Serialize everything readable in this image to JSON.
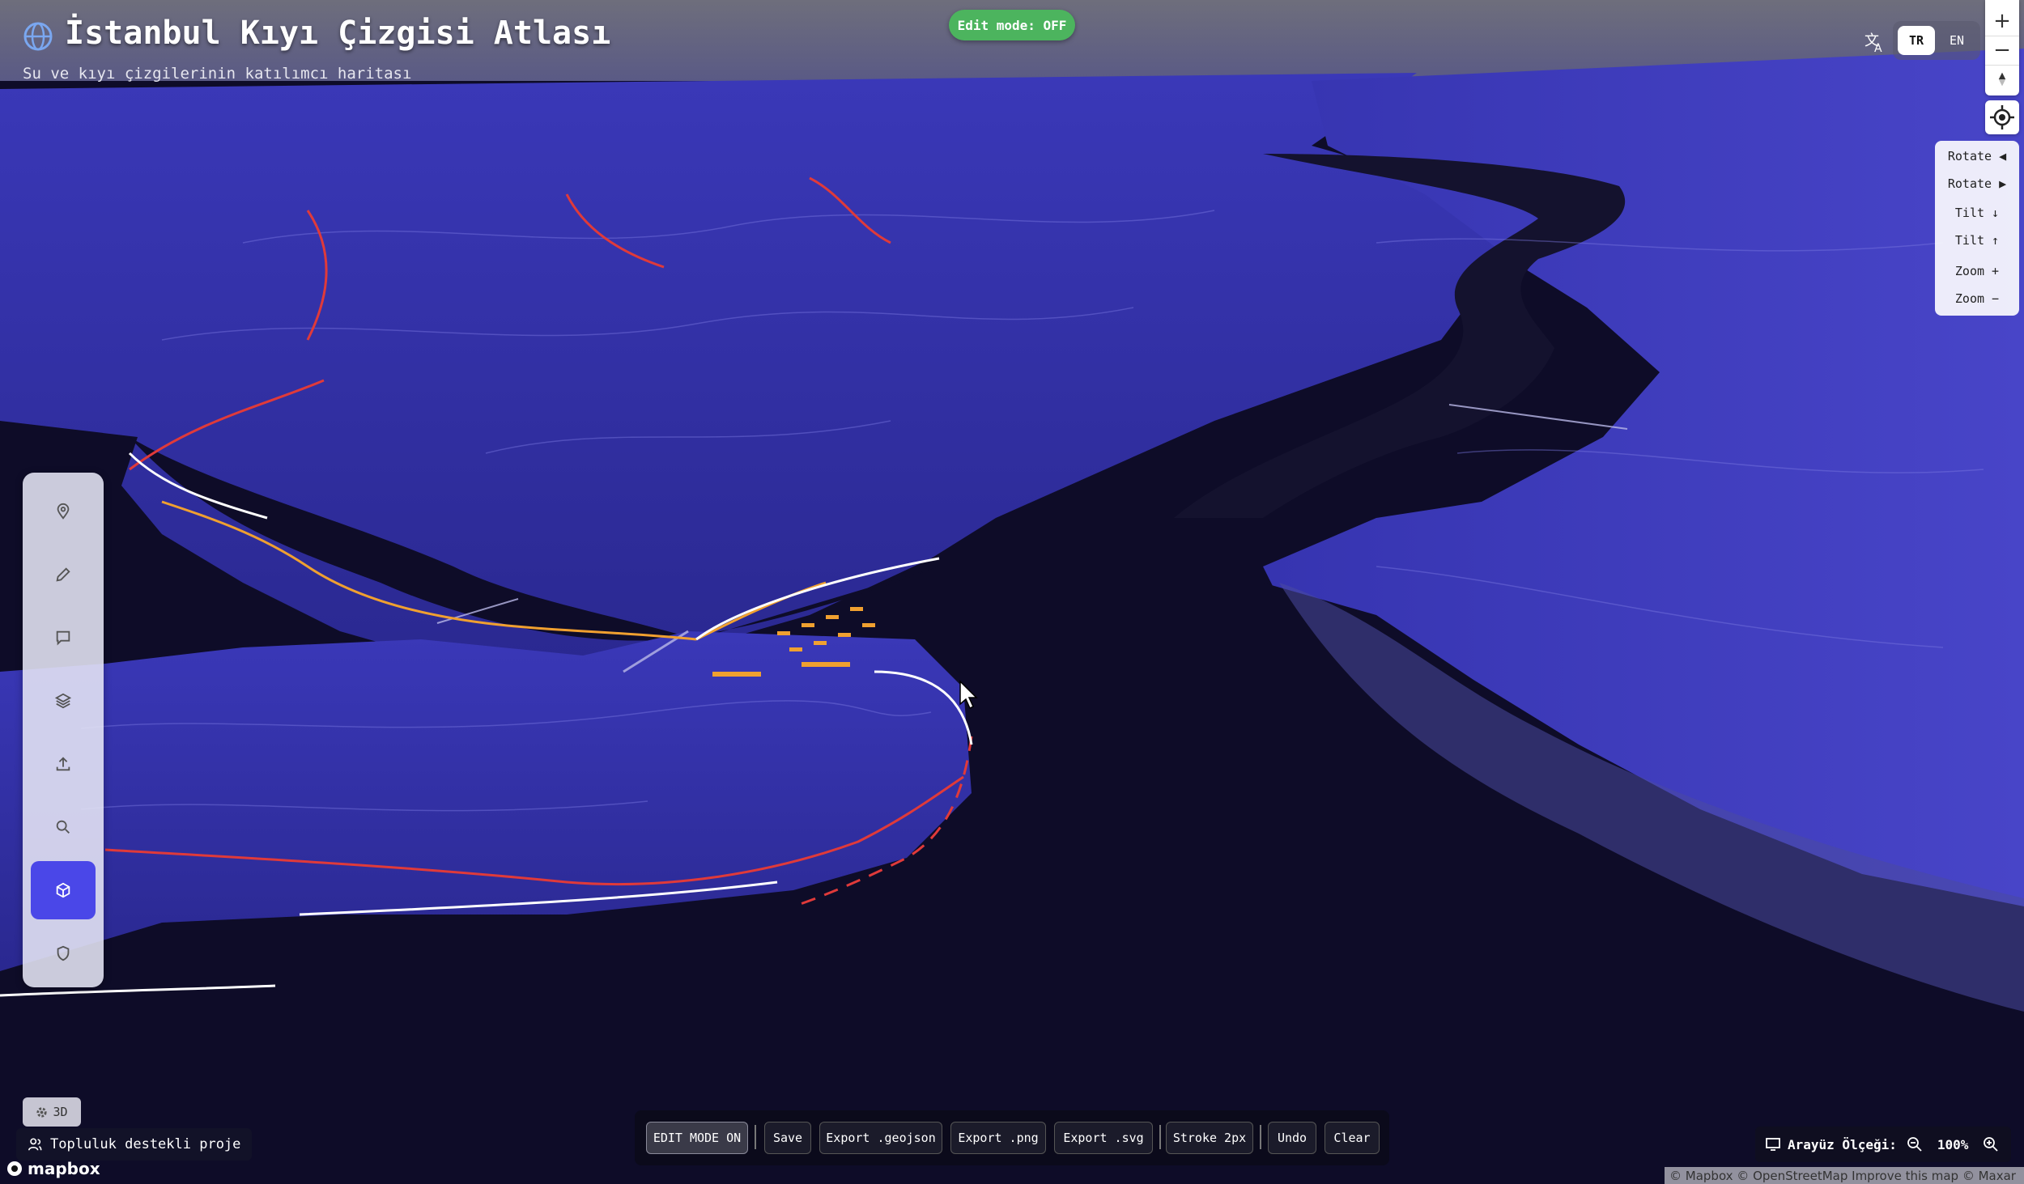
{
  "header": {
    "title": "İstanbul Kıyı Çizgisi Atlası",
    "subtitle": "Su ve kıyı çizgilerinin katılımcı haritası",
    "icon": "globe-icon"
  },
  "edit_badge": "Edit mode: OFF",
  "language": {
    "icon": "translate-icon",
    "options": [
      "TR",
      "EN"
    ],
    "selected": "TR"
  },
  "zoom_controls": {
    "zoom_in": "+",
    "zoom_out": "−",
    "compass_icon": "compass-icon",
    "locate_icon": "locate-icon"
  },
  "map_controls": [
    "Rotate ◀",
    "Rotate ▶",
    "Tilt ↓",
    "Tilt ↑",
    "Zoom +",
    "Zoom −"
  ],
  "left_toolbar": {
    "tools": [
      {
        "icon": "map-pin-icon"
      },
      {
        "icon": "pencil-icon"
      },
      {
        "icon": "comment-icon"
      },
      {
        "icon": "layers-icon"
      },
      {
        "icon": "upload-icon"
      },
      {
        "icon": "search-icon"
      },
      {
        "icon": "cube-icon",
        "active": true
      },
      {
        "icon": "shield-icon"
      }
    ]
  },
  "view_toggle": "3D",
  "community_label": "Topluluk destekli proje",
  "mapbox_logo": "mapbox",
  "bottom_toolbar": {
    "buttons": [
      "EDIT MODE ON",
      "Save",
      "Export .geojson",
      "Export .png",
      "Export .svg",
      "Stroke 2px",
      "Undo",
      "Clear"
    ]
  },
  "ui_scale": {
    "label": "Arayüz Ölçeği:",
    "value": "100%"
  },
  "attribution": "© Mapbox © OpenStreetMap Improve this map © Maxar",
  "colors": {
    "land": "#2c2a9e",
    "water": "#0d0b24",
    "edit_badge": "#4cb45e",
    "active_tool": "#4a47e8",
    "shoreline_red": "#e03a3a",
    "shoreline_orange": "#f0a030"
  }
}
